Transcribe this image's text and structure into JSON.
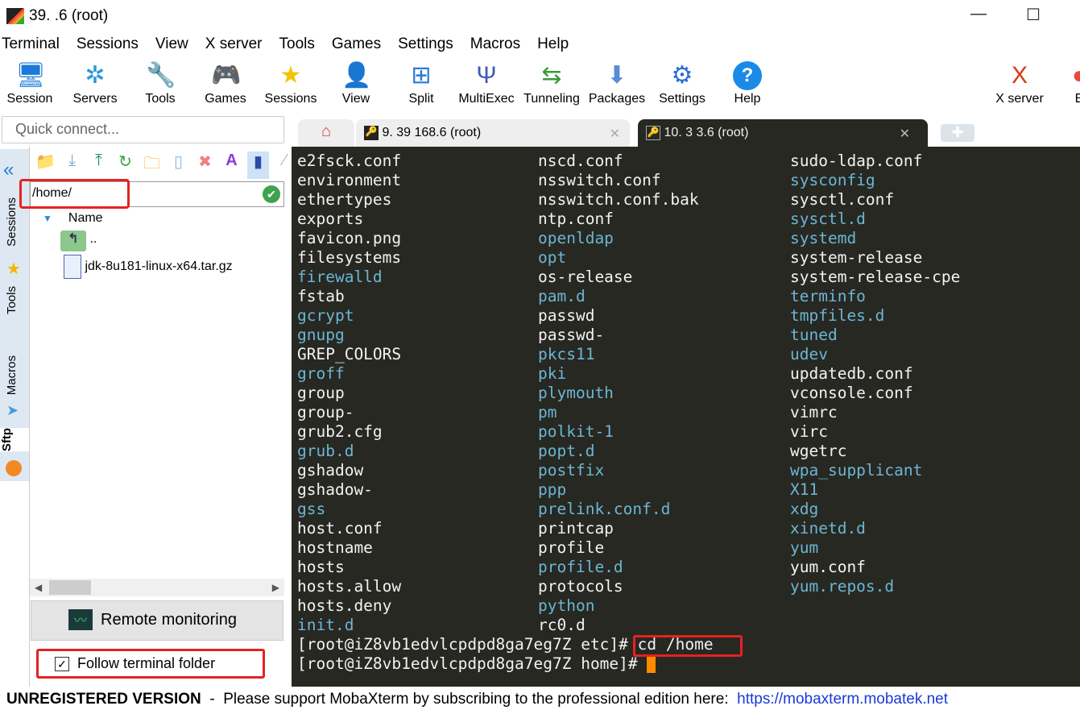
{
  "window": {
    "title": "39.   .6 (root)",
    "minimize": "—",
    "maximize": "☐"
  },
  "menu": [
    "Terminal",
    "Sessions",
    "View",
    "X server",
    "Tools",
    "Games",
    "Settings",
    "Macros",
    "Help"
  ],
  "toolbar": [
    {
      "label": "Session",
      "icon": "session-icon",
      "glyph": "🖥"
    },
    {
      "label": "Servers",
      "icon": "servers-icon",
      "glyph": "✲"
    },
    {
      "label": "Tools",
      "icon": "tools-icon",
      "glyph": "🔧"
    },
    {
      "label": "Games",
      "icon": "games-icon",
      "glyph": "🎮"
    },
    {
      "label": "Sessions",
      "icon": "star-icon",
      "glyph": "★"
    },
    {
      "label": "View",
      "icon": "view-icon",
      "glyph": "👤"
    },
    {
      "label": "Split",
      "icon": "split-icon",
      "glyph": "⊞"
    },
    {
      "label": "MultiExec",
      "icon": "multiexec-icon",
      "glyph": "Ψ"
    },
    {
      "label": "Tunneling",
      "icon": "tunneling-icon",
      "glyph": "⇆"
    },
    {
      "label": "Packages",
      "icon": "packages-icon",
      "glyph": "⬇"
    },
    {
      "label": "Settings",
      "icon": "settings-icon",
      "glyph": "⚙"
    },
    {
      "label": "Help",
      "icon": "help-icon",
      "glyph": "?"
    },
    {
      "label": "X server",
      "icon": "xserver-icon",
      "glyph": "X"
    },
    {
      "label": "E",
      "icon": "exit-icon",
      "glyph": "●"
    }
  ],
  "quick_connect": {
    "placeholder": "Quick connect..."
  },
  "tabs": [
    {
      "label": "9. 39   168.6 (root)"
    },
    {
      "label": "10. 3   3.6 (root)",
      "active": true
    }
  ],
  "side_tabs": [
    "Sessions",
    "Tools",
    "Macros",
    "Sftp"
  ],
  "sftp": {
    "path": "/home/",
    "column_header": "Name",
    "files": [
      {
        "name": "..",
        "type": "parent"
      },
      {
        "name": "jdk-8u181-linux-x64.tar.gz",
        "type": "archive"
      }
    ],
    "remote_monitoring": "Remote monitoring",
    "follow_label": "Follow terminal folder",
    "follow_checked": true
  },
  "terminal": {
    "columns": [
      [
        [
          "e2fsck.conf",
          "f"
        ],
        [
          "environment",
          "f"
        ],
        [
          "ethertypes",
          "f"
        ],
        [
          "exports",
          "f"
        ],
        [
          "favicon.png",
          "f"
        ],
        [
          "filesystems",
          "f"
        ],
        [
          "firewalld",
          "d"
        ],
        [
          "fstab",
          "f"
        ],
        [
          "gcrypt",
          "d"
        ],
        [
          "gnupg",
          "d"
        ],
        [
          "GREP_COLORS",
          "f"
        ],
        [
          "groff",
          "d"
        ],
        [
          "group",
          "f"
        ],
        [
          "group-",
          "f"
        ],
        [
          "grub2.cfg",
          "f"
        ],
        [
          "grub.d",
          "d"
        ],
        [
          "gshadow",
          "f"
        ],
        [
          "gshadow-",
          "f"
        ],
        [
          "gss",
          "d"
        ],
        [
          "host.conf",
          "f"
        ],
        [
          "hostname",
          "f"
        ],
        [
          "hosts",
          "f"
        ],
        [
          "hosts.allow",
          "f"
        ],
        [
          "hosts.deny",
          "f"
        ],
        [
          "init.d",
          "d"
        ]
      ],
      [
        [
          "nscd.conf",
          "f"
        ],
        [
          "nsswitch.conf",
          "f"
        ],
        [
          "nsswitch.conf.bak",
          "f"
        ],
        [
          "ntp.conf",
          "f"
        ],
        [
          "openldap",
          "d"
        ],
        [
          "opt",
          "d"
        ],
        [
          "os-release",
          "f"
        ],
        [
          "pam.d",
          "d"
        ],
        [
          "passwd",
          "f"
        ],
        [
          "passwd-",
          "f"
        ],
        [
          "pkcs11",
          "d"
        ],
        [
          "pki",
          "d"
        ],
        [
          "plymouth",
          "d"
        ],
        [
          "pm",
          "d"
        ],
        [
          "polkit-1",
          "d"
        ],
        [
          "popt.d",
          "d"
        ],
        [
          "postfix",
          "d"
        ],
        [
          "ppp",
          "d"
        ],
        [
          "prelink.conf.d",
          "d"
        ],
        [
          "printcap",
          "f"
        ],
        [
          "profile",
          "f"
        ],
        [
          "profile.d",
          "d"
        ],
        [
          "protocols",
          "f"
        ],
        [
          "python",
          "d"
        ],
        [
          "rc0.d",
          "f"
        ]
      ],
      [
        [
          "sudo-ldap.conf",
          "f"
        ],
        [
          "sysconfig",
          "d"
        ],
        [
          "sysctl.conf",
          "f"
        ],
        [
          "sysctl.d",
          "d"
        ],
        [
          "systemd",
          "d"
        ],
        [
          "system-release",
          "f"
        ],
        [
          "system-release-cpe",
          "f"
        ],
        [
          "terminfo",
          "d"
        ],
        [
          "tmpfiles.d",
          "d"
        ],
        [
          "tuned",
          "d"
        ],
        [
          "udev",
          "d"
        ],
        [
          "updatedb.conf",
          "f"
        ],
        [
          "vconsole.conf",
          "f"
        ],
        [
          "vimrc",
          "f"
        ],
        [
          "virc",
          "f"
        ],
        [
          "wgetrc",
          "f"
        ],
        [
          "wpa_supplicant",
          "d"
        ],
        [
          "X11",
          "d"
        ],
        [
          "xdg",
          "d"
        ],
        [
          "xinetd.d",
          "d"
        ],
        [
          "yum",
          "d"
        ],
        [
          "yum.conf",
          "f"
        ],
        [
          "yum.repos.d",
          "d"
        ]
      ]
    ],
    "prompt1": "[root@iZ8vb1edvlcpdpd8ga7eg7Z etc]#",
    "command1": " cd /home",
    "prompt2": "[root@iZ8vb1edvlcpdpd8ga7eg7Z home]#",
    "colors": {
      "background": "#272822",
      "text": "#f2f2f2",
      "directory": "#6cb6d4",
      "cursor": "#ff8c00"
    }
  },
  "footer": {
    "unregistered": "UNREGISTERED VERSION",
    "message": "  -  Please support MobaXterm by subscribing to the professional edition here:  ",
    "link": "https://mobaxterm.mobatek.net"
  }
}
